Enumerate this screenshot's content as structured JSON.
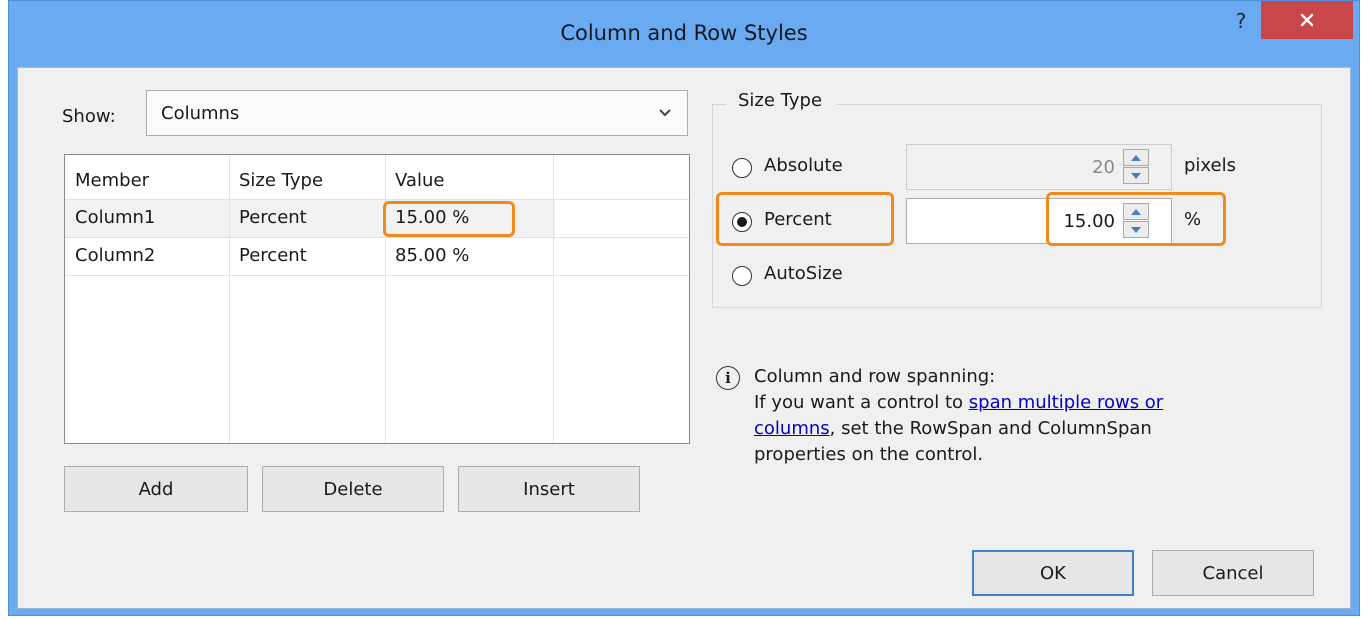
{
  "window": {
    "title": "Column and Row Styles",
    "help_label": "?"
  },
  "show": {
    "label": "Show:",
    "selected": "Columns"
  },
  "grid": {
    "columns": [
      "Member",
      "Size Type",
      "Value"
    ],
    "rows": [
      {
        "member": "Column1",
        "size_type": "Percent",
        "value": "15.00 %"
      },
      {
        "member": "Column2",
        "size_type": "Percent",
        "value": "85.00 %"
      }
    ],
    "selected_row_index": 0
  },
  "buttons": {
    "add": "Add",
    "delete": "Delete",
    "insert": "Insert",
    "ok": "OK",
    "cancel": "Cancel"
  },
  "size_type": {
    "title": "Size Type",
    "absolute": {
      "label": "Absolute",
      "value": "20",
      "unit": "pixels",
      "checked": false
    },
    "percent": {
      "label": "Percent",
      "value": "15.00",
      "unit": "%",
      "checked": true
    },
    "autosize": {
      "label": "AutoSize",
      "checked": false
    }
  },
  "info": {
    "heading": "Column and row spanning:",
    "text_before_link": "If you want a control to ",
    "link_text_1": "span multiple rows or",
    "link_text_2": "columns",
    "text_after_link_1": ", set the RowSpan and ColumnSpan",
    "text_after_link_2": "properties on the control."
  },
  "colors": {
    "titlebar": "#6aaaf0",
    "close_button": "#c9474b",
    "highlight": "#f08a1c",
    "link": "#0000cc"
  }
}
